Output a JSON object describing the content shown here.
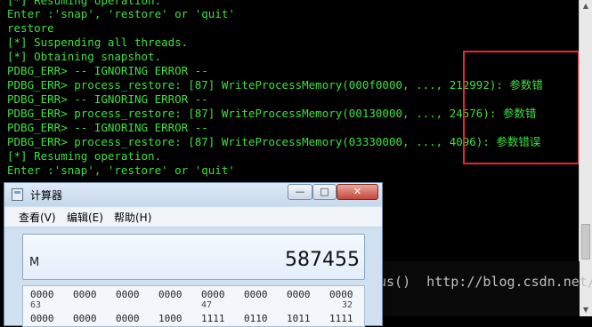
{
  "console": {
    "lines": [
      "[*] Resuming operation.",
      "Enter :'snap', 'restore' or 'quit'",
      "restore",
      "[*] Suspending all threads.",
      "[*] Obtaining snapshot.",
      "PDBG_ERR> -- IGNORING ERROR --",
      "PDBG_ERR> process_restore: [87] WriteProcessMemory(000f0000, ..., 212992): 参数错",
      "PDBG_ERR> -- IGNORING ERROR --",
      "PDBG_ERR> process_restore: [87] WriteProcessMemory(00130000, ..., 24576): 参数错",
      "PDBG_ERR> -- IGNORING ERROR --",
      "PDBG_ERR> process_restore: [87] WriteProcessMemory(03330000, ..., 4096): 参数错误",
      "[*] Resuming operation.",
      "Enter :'snap', 'restore' or 'quit'"
    ],
    "text_color": "#3ee03e",
    "highlight_color": "#e8262b"
  },
  "background_window": {
    "text": "us()  http://blog.csdn.net/"
  },
  "calculator": {
    "title": "计算器",
    "min_label": "—",
    "max_label": "□",
    "close_label": "✕",
    "menus": [
      "查看(V)",
      "编辑(E)",
      "帮助(H)"
    ],
    "memory_indicator": "M",
    "display_value": "587455",
    "bit_groups_row1": [
      "0000",
      "0000",
      "0000",
      "0000",
      "0000",
      "0000",
      "0000",
      "0000"
    ],
    "bit_markers_row1": [
      "63",
      "47",
      "32"
    ],
    "bit_groups_row2": [
      "0000",
      "0000",
      "0000",
      "1000",
      "1111",
      "0110",
      "1011",
      "1111"
    ]
  }
}
